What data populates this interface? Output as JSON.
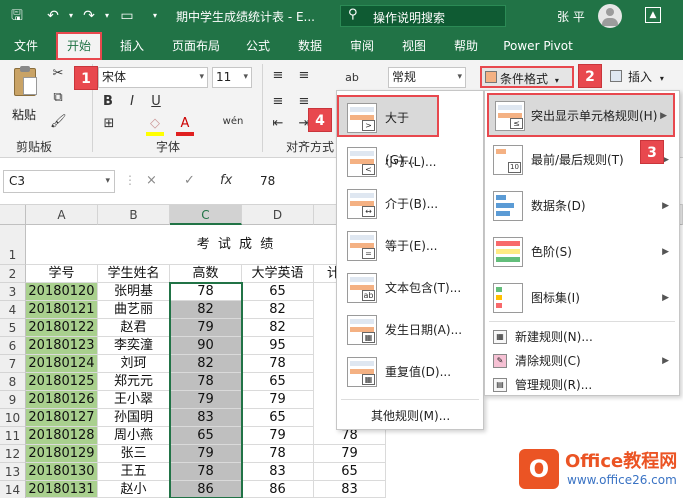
{
  "titlebar": {
    "title": "期中学生成绩统计表 - E...",
    "search": "操作说明搜索",
    "user": "张 平"
  },
  "tabs": [
    "文件",
    "开始",
    "插入",
    "页面布局",
    "公式",
    "数据",
    "审阅",
    "视图",
    "帮助",
    "Power Pivot"
  ],
  "ribbon": {
    "paste_label": "粘贴",
    "clipboard_label": "剪贴板",
    "font_name": "宋体",
    "font_size": "11",
    "bold": "B",
    "italic": "I",
    "underline": "U",
    "font_label": "字体",
    "align_label": "对齐方式",
    "wen": "wén",
    "number_format": "常规",
    "cond_format": "条件格式",
    "insert": "插入"
  },
  "badges": [
    "1",
    "2",
    "3",
    "4"
  ],
  "formula_bar": {
    "name_box": "C3",
    "cancel": "×",
    "confirm": "✓",
    "fx": "fx",
    "value": "78"
  },
  "sheet": {
    "columns": [
      "A",
      "B",
      "C",
      "D"
    ],
    "title": "考 试 成 绩",
    "row_numbers": [
      "1",
      "2",
      "3",
      "4",
      "5",
      "6",
      "7",
      "8",
      "9",
      "10",
      "11",
      "12",
      "13",
      "14"
    ],
    "headers": [
      "学号",
      "学生姓名",
      "高数",
      "大学英语",
      "计"
    ],
    "rows": [
      [
        "20180120",
        "张明基",
        "78",
        "65",
        ""
      ],
      [
        "20180121",
        "曲艺丽",
        "82",
        "82",
        ""
      ],
      [
        "20180122",
        "赵君",
        "79",
        "82",
        ""
      ],
      [
        "20180123",
        "李奕潼",
        "90",
        "95",
        ""
      ],
      [
        "20180124",
        "刘珂",
        "82",
        "78",
        ""
      ],
      [
        "20180125",
        "郑元元",
        "78",
        "65",
        ""
      ],
      [
        "20180126",
        "王小翠",
        "79",
        "79",
        ""
      ],
      [
        "20180127",
        "孙国明",
        "83",
        "65",
        ""
      ],
      [
        "20180128",
        "周小燕",
        "65",
        "79",
        "78"
      ],
      [
        "20180129",
        "张三",
        "79",
        "78",
        "79"
      ],
      [
        "20180130",
        "王五",
        "78",
        "83",
        "65"
      ],
      [
        "20180131",
        "赵小",
        "86",
        "86",
        "83"
      ]
    ]
  },
  "menu_left": {
    "items": [
      "大于(G)...",
      "小于(L)...",
      "介于(B)...",
      "等于(E)...",
      "文本包含(T)...",
      "发生日期(A)...",
      "重复值(D)..."
    ],
    "symbols": [
      ">",
      "<",
      "↔",
      "=",
      "ab",
      "▦",
      "▦"
    ],
    "more": "其他规则(M)..."
  },
  "menu_right": {
    "items": [
      "突出显示单元格规则(H)",
      "最前/最后规则(T)",
      "数据条(D)",
      "色阶(S)",
      "图标集(I)"
    ],
    "small_items": [
      "新建规则(N)...",
      "清除规则(C)",
      "管理规则(R)..."
    ]
  },
  "watermark": {
    "logo": "O",
    "line1": "Office教程网",
    "line2": "www.office26.com"
  },
  "colors": {
    "excel_green": "#217346",
    "highlight_red": "#e8484e",
    "cell_green": "#a9d08e",
    "cell_gray": "#bfbfbf"
  }
}
